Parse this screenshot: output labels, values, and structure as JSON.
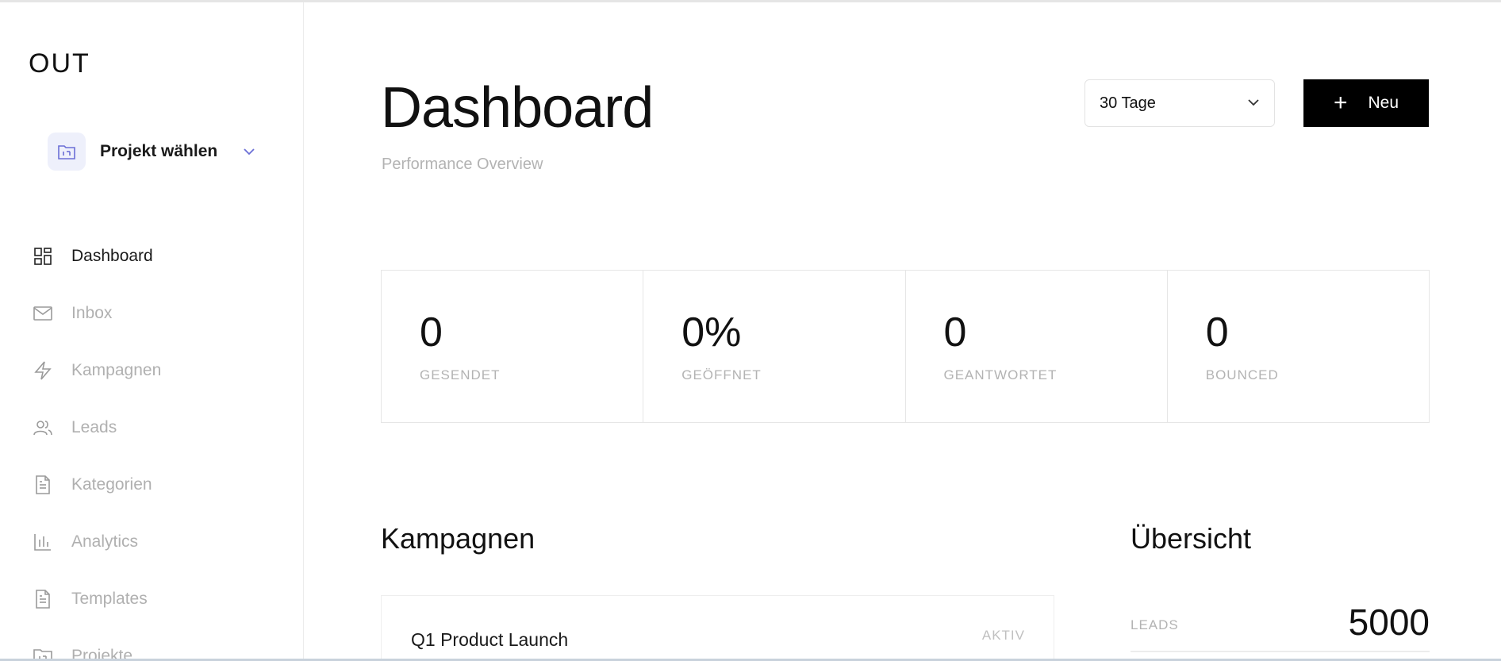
{
  "app": {
    "logo": "OUT"
  },
  "sidebar": {
    "project_picker": {
      "label": "Projekt wählen"
    },
    "items": [
      {
        "label": "Dashboard",
        "icon": "grid-icon",
        "active": true
      },
      {
        "label": "Inbox",
        "icon": "mail-icon",
        "active": false
      },
      {
        "label": "Kampagnen",
        "icon": "lightning-icon",
        "active": false
      },
      {
        "label": "Leads",
        "icon": "users-icon",
        "active": false
      },
      {
        "label": "Kategorien",
        "icon": "document-icon",
        "active": false
      },
      {
        "label": "Analytics",
        "icon": "bar-chart-icon",
        "active": false
      },
      {
        "label": "Templates",
        "icon": "document-icon",
        "active": false
      },
      {
        "label": "Projekte",
        "icon": "folder-icon",
        "active": false
      }
    ]
  },
  "header": {
    "title": "Dashboard",
    "subtitle": "Performance Overview",
    "range_select": {
      "value": "30 Tage"
    },
    "new_button": {
      "label": "Neu"
    }
  },
  "stats": [
    {
      "value": "0",
      "label": "GESENDET"
    },
    {
      "value": "0%",
      "label": "GEÖFFNET"
    },
    {
      "value": "0",
      "label": "GEANTWORTET"
    },
    {
      "value": "0",
      "label": "BOUNCED"
    }
  ],
  "campaigns": {
    "title": "Kampagnen",
    "items": [
      {
        "name": "Q1 Product Launch",
        "status": "AKTIV"
      }
    ]
  },
  "overview": {
    "title": "Übersicht",
    "rows": [
      {
        "key": "LEADS",
        "value": "5000"
      }
    ]
  },
  "colors": {
    "accent": "#000000",
    "muted_text": "#b3b3b3",
    "icon_box_bg": "#eef0fb",
    "icon_accent": "#6b6fd6"
  }
}
